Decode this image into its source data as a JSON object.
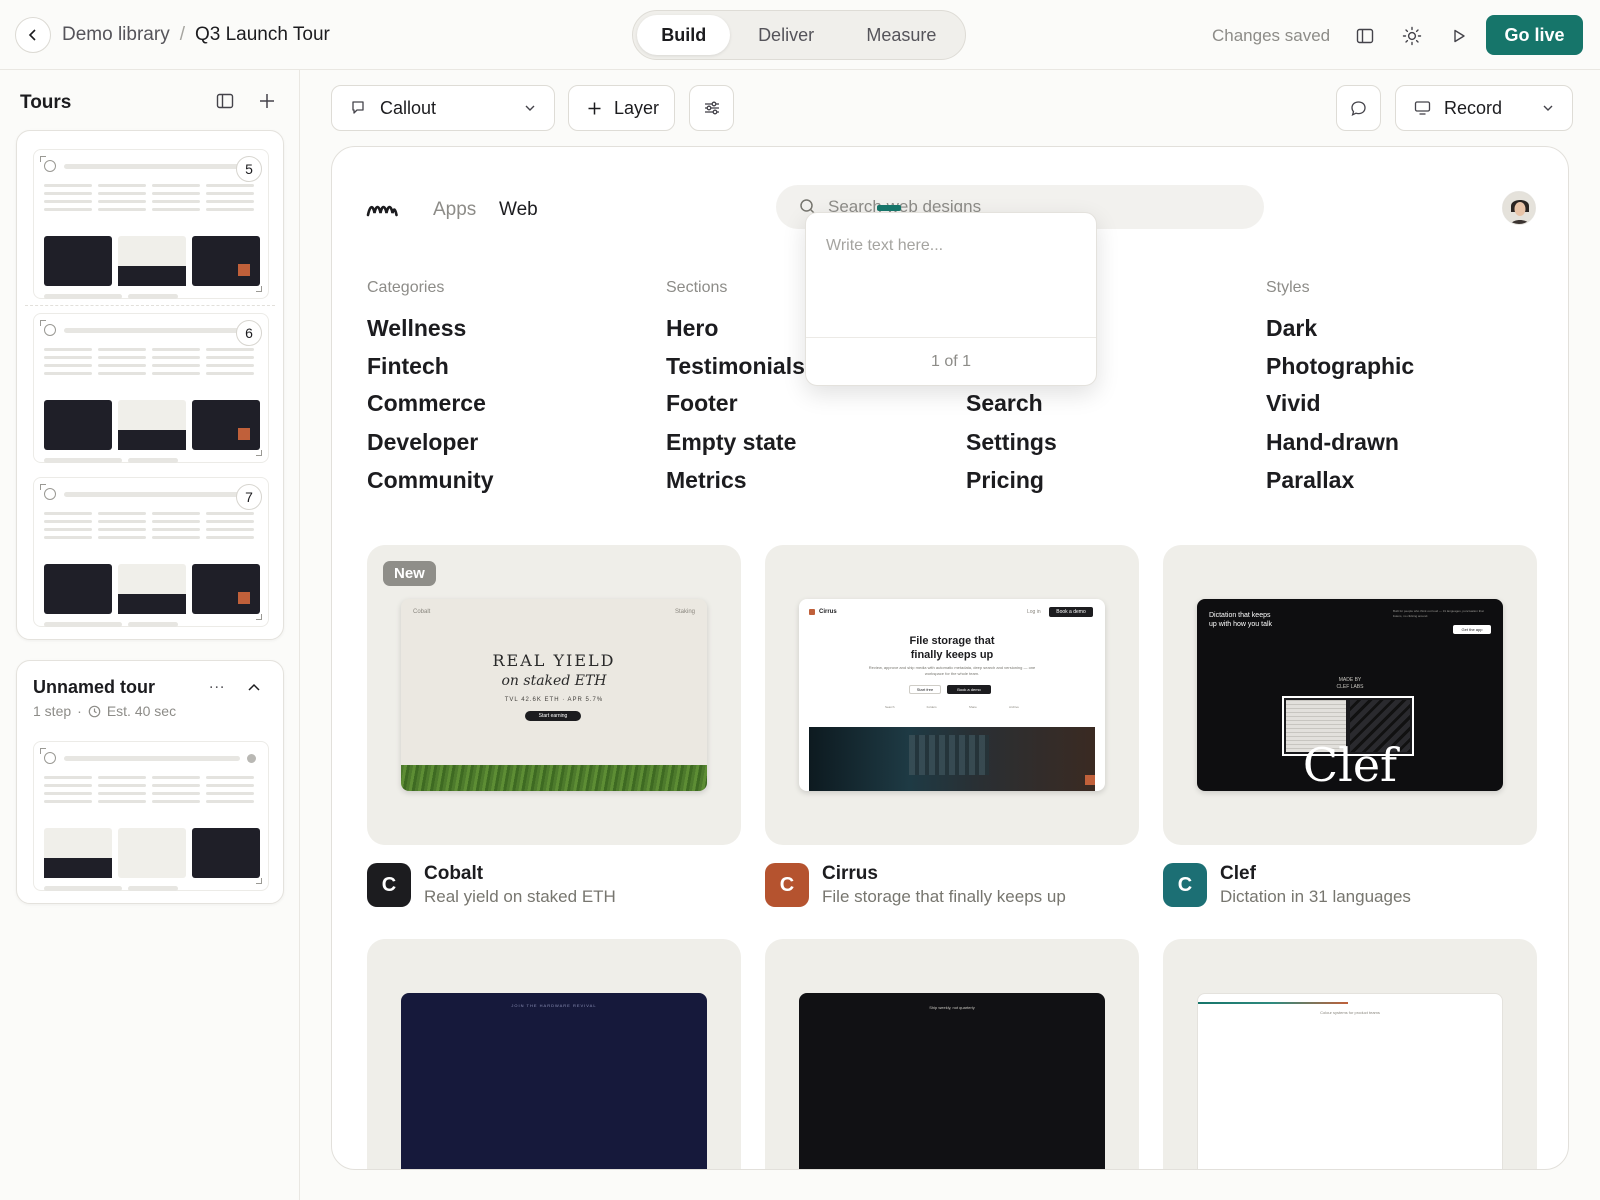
{
  "header": {
    "breadcrumb_parent": "Demo library",
    "breadcrumb_sep": "/",
    "breadcrumb_current": "Q3 Launch Tour",
    "tabs": [
      "Build",
      "Deliver",
      "Measure"
    ],
    "status": "Changes saved",
    "go_live": "Go live"
  },
  "sidebar": {
    "title": "Tours",
    "tour_badges": [
      "5",
      "6",
      "7"
    ],
    "unnamed": {
      "title": "Unnamed tour",
      "steps": "1 step",
      "sep": "·",
      "estimate": "Est. 40 sec",
      "menu": "..."
    }
  },
  "toolbar": {
    "callout": "Callout",
    "layer": "Layer",
    "record": "Record"
  },
  "canvas": {
    "nav": {
      "apps": "Apps",
      "web": "Web"
    },
    "search_placeholder": "Search web designs",
    "columns": [
      {
        "label": "Categories",
        "items": [
          "Wellness",
          "Fintech",
          "Commerce",
          "Developer",
          "Community"
        ]
      },
      {
        "label": "Sections",
        "items": [
          "Hero",
          "Testimonials",
          "Footer",
          "Empty state",
          "Metrics"
        ]
      },
      {
        "label": "",
        "items": [
          "",
          "",
          "Search",
          "Settings",
          "Pricing"
        ]
      },
      {
        "label": "Styles",
        "items": [
          "Dark",
          "Photographic",
          "Vivid",
          "Hand-drawn",
          "Parallax"
        ]
      }
    ],
    "popover": {
      "placeholder": "Write text here...",
      "count": "1 of 1"
    },
    "cards": [
      {
        "badge": "New",
        "icon_letter": "C",
        "name": "Cobalt",
        "desc": "Real yield on staked ETH",
        "icon_color": "#1c1c1f",
        "preview": {
          "brand": "Cobalt",
          "nav": "Staking",
          "headline1": "REAL YIELD",
          "headline2": "on staked ETH",
          "stats": "TVL 42.6K ETH  ·  APR 5.7%",
          "cta": "Start earning"
        }
      },
      {
        "icon_letter": "C",
        "name": "Cirrus",
        "desc": "File storage that finally keeps up",
        "icon_color": "#b5532f",
        "preview": {
          "brand": "Cirrus",
          "login": "Log in",
          "demo": "Book a demo",
          "headline1": "File storage that",
          "headline2": "finally keeps up",
          "sub": "Review, approve and ship media with automatic metadata, deep search and versioning — one workspace for the whole team.",
          "cta1": "Start free",
          "cta2": "Book a demo",
          "features": [
            "Search",
            "Folders",
            "Share",
            "Archive"
          ]
        }
      },
      {
        "icon_letter": "C",
        "name": "Clef",
        "desc": "Dictation in 31 languages",
        "icon_color": "#1c6f74",
        "preview": {
          "headline1": "Dictation that keeps",
          "headline2": "up with how you talk",
          "side": "Built for people who think out loud — 31 languages, punctuation that listens, no clicking around.",
          "cta": "Get the app",
          "made1": "MADE BY",
          "made2": "CLEF LABS",
          "word": "Clef"
        }
      }
    ],
    "more_cards": [
      {
        "caption": "JOIN THE HARDWARE REVIVAL",
        "bg": "#16193b"
      },
      {
        "caption": "Ship weekly, not quarterly",
        "bg": "#111114"
      },
      {
        "caption": "Colour systems for product teams",
        "bg": "#ffffff"
      }
    ]
  },
  "colors": {
    "accent": "#16756a",
    "dark_block": "#1f1f28",
    "orange": "#c0603a"
  }
}
